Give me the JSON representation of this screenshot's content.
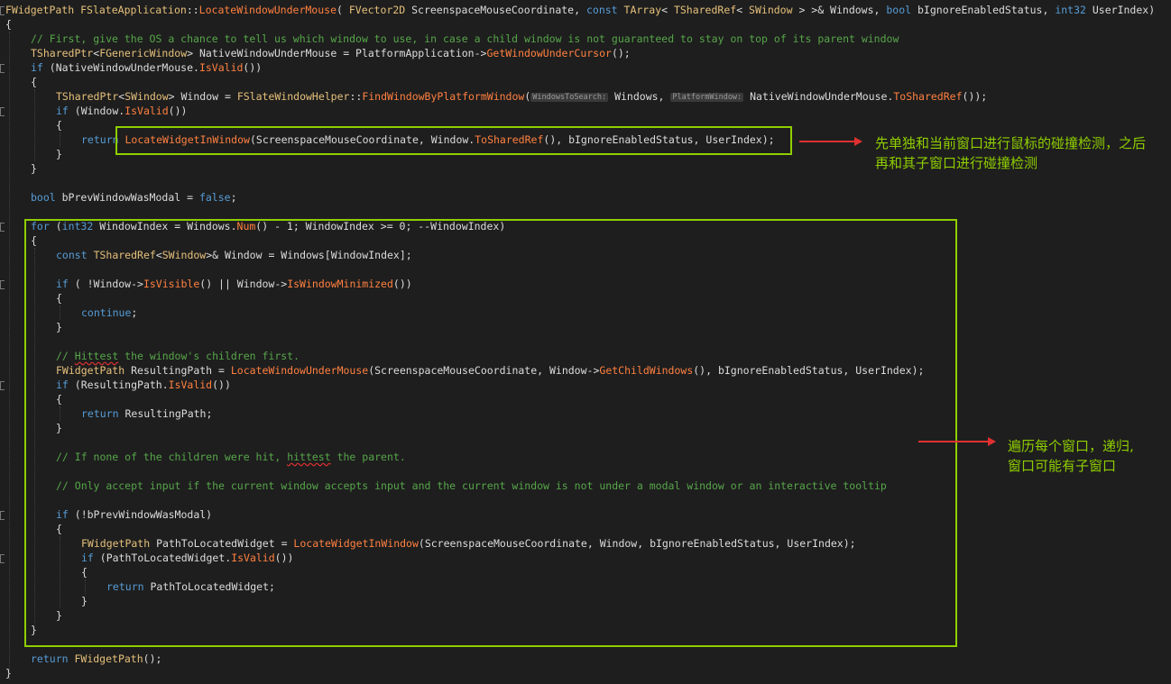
{
  "editor": {
    "lines": [
      {
        "indent": 0,
        "tokens": [
          [
            "cl",
            "FWidgetPath"
          ],
          [
            "pl",
            " "
          ],
          [
            "cl",
            "FSlateApplication"
          ],
          [
            "pl",
            "::"
          ],
          [
            "fn",
            "LocateWindowUnderMouse"
          ],
          [
            "pl",
            "( "
          ],
          [
            "cl",
            "FVector2D"
          ],
          [
            "pl",
            " ScreenspaceMouseCoordinate, "
          ],
          [
            "kw",
            "const"
          ],
          [
            "pl",
            " "
          ],
          [
            "cl",
            "TArray"
          ],
          [
            "pl",
            "< "
          ],
          [
            "cl",
            "TSharedRef"
          ],
          [
            "pl",
            "< "
          ],
          [
            "cl",
            "SWindow"
          ],
          [
            "pl",
            " > >& Windows, "
          ],
          [
            "kw",
            "bool"
          ],
          [
            "pl",
            " bIgnoreEnabledStatus, "
          ],
          [
            "kw",
            "int32"
          ],
          [
            "pl",
            " UserIndex)"
          ]
        ]
      },
      {
        "indent": 0,
        "tokens": [
          [
            "pl",
            "{"
          ]
        ]
      },
      {
        "indent": 1,
        "tokens": [
          [
            "cm",
            "// First, give the OS a chance to tell us which window to use, in case a child window is not guaranteed to stay on top of its parent window"
          ]
        ]
      },
      {
        "indent": 1,
        "tokens": [
          [
            "cl",
            "TSharedPtr"
          ],
          [
            "pl",
            "<"
          ],
          [
            "cl",
            "FGenericWindow"
          ],
          [
            "pl",
            "> NativeWindowUnderMouse = PlatformApplication->"
          ],
          [
            "fn",
            "GetWindowUnderCursor"
          ],
          [
            "pl",
            "();"
          ]
        ]
      },
      {
        "indent": 1,
        "tokens": [
          [
            "kw",
            "if"
          ],
          [
            "pl",
            " (NativeWindowUnderMouse."
          ],
          [
            "fn",
            "IsValid"
          ],
          [
            "pl",
            "())"
          ]
        ]
      },
      {
        "indent": 1,
        "tokens": [
          [
            "pl",
            "{"
          ]
        ]
      },
      {
        "indent": 2,
        "tokens": [
          [
            "cl",
            "TSharedPtr"
          ],
          [
            "pl",
            "<"
          ],
          [
            "cl",
            "SWindow"
          ],
          [
            "pl",
            "> Window = "
          ],
          [
            "cl",
            "FSlateWindowHelper"
          ],
          [
            "pl",
            "::"
          ],
          [
            "fn",
            "FindWindowByPlatformWindow"
          ],
          [
            "pl",
            "("
          ],
          [
            "hn",
            "WindowsToSearch:"
          ],
          [
            "pl",
            " Windows, "
          ],
          [
            "hn",
            "PlatformWindow:"
          ],
          [
            "pl",
            " NativeWindowUnderMouse."
          ],
          [
            "fn",
            "ToSharedRef"
          ],
          [
            "pl",
            "());"
          ]
        ]
      },
      {
        "indent": 2,
        "tokens": [
          [
            "kw",
            "if"
          ],
          [
            "pl",
            " (Window."
          ],
          [
            "fn",
            "IsValid"
          ],
          [
            "pl",
            "())"
          ]
        ]
      },
      {
        "indent": 2,
        "tokens": [
          [
            "pl",
            "{"
          ]
        ]
      },
      {
        "indent": 3,
        "tokens": [
          [
            "kw",
            "return"
          ],
          [
            "pl",
            " "
          ],
          [
            "fn",
            "LocateWidgetInWindow"
          ],
          [
            "pl",
            "(ScreenspaceMouseCoordinate, Window."
          ],
          [
            "fn",
            "ToSharedRef"
          ],
          [
            "pl",
            "(), bIgnoreEnabledStatus, UserIndex);"
          ]
        ]
      },
      {
        "indent": 2,
        "tokens": [
          [
            "pl",
            "}"
          ]
        ]
      },
      {
        "indent": 1,
        "tokens": [
          [
            "pl",
            "}"
          ]
        ]
      },
      {
        "indent": 0,
        "tokens": []
      },
      {
        "indent": 1,
        "tokens": [
          [
            "kw",
            "bool"
          ],
          [
            "pl",
            " bPrevWindowWasModal = "
          ],
          [
            "kw",
            "false"
          ],
          [
            "pl",
            ";"
          ]
        ]
      },
      {
        "indent": 0,
        "tokens": []
      },
      {
        "indent": 1,
        "tokens": [
          [
            "kw",
            "for"
          ],
          [
            "pl",
            " ("
          ],
          [
            "kw",
            "int32"
          ],
          [
            "pl",
            " WindowIndex = Windows."
          ],
          [
            "fn",
            "Num"
          ],
          [
            "pl",
            "() - 1; WindowIndex >= 0; --WindowIndex)"
          ]
        ]
      },
      {
        "indent": 1,
        "tokens": [
          [
            "pl",
            "{"
          ]
        ]
      },
      {
        "indent": 2,
        "tokens": [
          [
            "kw",
            "const"
          ],
          [
            "pl",
            " "
          ],
          [
            "cl",
            "TSharedRef"
          ],
          [
            "pl",
            "<"
          ],
          [
            "cl",
            "SWindow"
          ],
          [
            "pl",
            ">& Window = Windows[WindowIndex];"
          ]
        ]
      },
      {
        "indent": 0,
        "tokens": []
      },
      {
        "indent": 2,
        "tokens": [
          [
            "kw",
            "if"
          ],
          [
            "pl",
            " ( !Window->"
          ],
          [
            "fn",
            "IsVisible"
          ],
          [
            "pl",
            "() || Window->"
          ],
          [
            "fn",
            "IsWindowMinimized"
          ],
          [
            "pl",
            "())"
          ]
        ]
      },
      {
        "indent": 2,
        "tokens": [
          [
            "pl",
            "{"
          ]
        ]
      },
      {
        "indent": 3,
        "tokens": [
          [
            "kw",
            "continue"
          ],
          [
            "pl",
            ";"
          ]
        ]
      },
      {
        "indent": 2,
        "tokens": [
          [
            "pl",
            "}"
          ]
        ]
      },
      {
        "indent": 0,
        "tokens": []
      },
      {
        "indent": 2,
        "tokens": [
          [
            "cm",
            "// "
          ],
          [
            "cmsq",
            "Hittest"
          ],
          [
            "cm",
            " the window's children first."
          ]
        ]
      },
      {
        "indent": 2,
        "tokens": [
          [
            "cl",
            "FWidgetPath"
          ],
          [
            "pl",
            " ResultingPath = "
          ],
          [
            "fn",
            "LocateWindowUnderMouse"
          ],
          [
            "pl",
            "(ScreenspaceMouseCoordinate, Window->"
          ],
          [
            "fn",
            "GetChildWindows"
          ],
          [
            "pl",
            "(), bIgnoreEnabledStatus, UserIndex);"
          ]
        ]
      },
      {
        "indent": 2,
        "tokens": [
          [
            "kw",
            "if"
          ],
          [
            "pl",
            " (ResultingPath."
          ],
          [
            "fn",
            "IsValid"
          ],
          [
            "pl",
            "())"
          ]
        ]
      },
      {
        "indent": 2,
        "tokens": [
          [
            "pl",
            "{"
          ]
        ]
      },
      {
        "indent": 3,
        "tokens": [
          [
            "kw",
            "return"
          ],
          [
            "pl",
            " ResultingPath;"
          ]
        ]
      },
      {
        "indent": 2,
        "tokens": [
          [
            "pl",
            "}"
          ]
        ]
      },
      {
        "indent": 0,
        "tokens": []
      },
      {
        "indent": 2,
        "tokens": [
          [
            "cm",
            "// If none of the children were hit, "
          ],
          [
            "cmsq",
            "hittest"
          ],
          [
            "cm",
            " the parent."
          ]
        ]
      },
      {
        "indent": 0,
        "tokens": []
      },
      {
        "indent": 2,
        "tokens": [
          [
            "cm",
            "// Only accept input if the current window accepts input and the current window is not under a modal window or an interactive tooltip"
          ]
        ]
      },
      {
        "indent": 0,
        "tokens": []
      },
      {
        "indent": 2,
        "tokens": [
          [
            "kw",
            "if"
          ],
          [
            "pl",
            " (!bPrevWindowWasModal)"
          ]
        ]
      },
      {
        "indent": 2,
        "tokens": [
          [
            "pl",
            "{"
          ]
        ]
      },
      {
        "indent": 3,
        "tokens": [
          [
            "cl",
            "FWidgetPath"
          ],
          [
            "pl",
            " PathToLocatedWidget = "
          ],
          [
            "fn",
            "LocateWidgetInWindow"
          ],
          [
            "pl",
            "(ScreenspaceMouseCoordinate, Window, bIgnoreEnabledStatus, UserIndex);"
          ]
        ]
      },
      {
        "indent": 3,
        "tokens": [
          [
            "kw",
            "if"
          ],
          [
            "pl",
            " (PathToLocatedWidget."
          ],
          [
            "fn",
            "IsValid"
          ],
          [
            "pl",
            "())"
          ]
        ]
      },
      {
        "indent": 3,
        "tokens": [
          [
            "pl",
            "{"
          ]
        ]
      },
      {
        "indent": 4,
        "tokens": [
          [
            "kw",
            "return"
          ],
          [
            "pl",
            " PathToLocatedWidget;"
          ]
        ]
      },
      {
        "indent": 3,
        "tokens": [
          [
            "pl",
            "}"
          ]
        ]
      },
      {
        "indent": 2,
        "tokens": [
          [
            "pl",
            "}"
          ]
        ]
      },
      {
        "indent": 1,
        "tokens": [
          [
            "pl",
            "}"
          ]
        ]
      },
      {
        "indent": 0,
        "tokens": []
      },
      {
        "indent": 1,
        "tokens": [
          [
            "kw",
            "return"
          ],
          [
            "pl",
            " "
          ],
          [
            "cl",
            "FWidgetPath"
          ],
          [
            "pl",
            "();"
          ]
        ]
      },
      {
        "indent": 0,
        "tokens": [
          [
            "pl",
            "}"
          ]
        ]
      }
    ]
  },
  "annotations": {
    "note_top": "先单独和当前窗口进行鼠标的碰撞检测，之后\n再和其子窗口进行碰撞检测",
    "note_bottom": "遍历每个窗口，递归,\n窗口可能有子窗口"
  },
  "colors": {
    "background": "#1e1e1e",
    "keyword": "#569cd6",
    "class": "#e6c07b",
    "function": "#ff8040",
    "comment": "#57a64a",
    "highlight_box": "#8fce00",
    "arrow": "#e03030",
    "note_text": "#8fce00"
  }
}
